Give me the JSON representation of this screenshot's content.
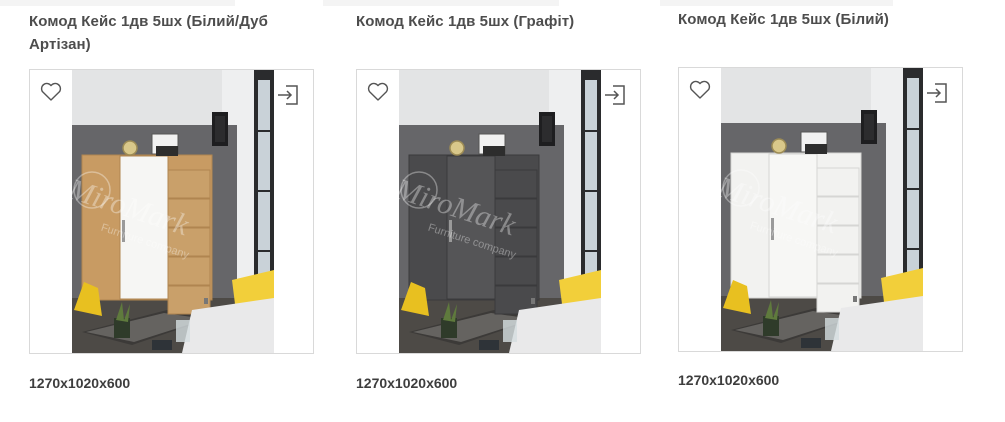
{
  "products": [
    {
      "title": "Комод Кейс 1дв 5шх (Білий/Дуб Артізан)",
      "dimensions": "1270x1020x600",
      "finish": "oak-white",
      "body_color": "#c89b63",
      "door_color": "#f6f6f4",
      "watermark": "MiroMark Furniture company"
    },
    {
      "title": "Комод Кейс 1дв 5шх (Графіт)",
      "dimensions": "1270x1020x600",
      "finish": "graphite",
      "body_color": "#4a4a4c",
      "door_color": "#555557",
      "watermark": "MiroMark Furniture company"
    },
    {
      "title": "Комод Кейс 1дв 5шх (Білий)",
      "dimensions": "1270x1020x600",
      "finish": "white",
      "body_color": "#f2f2f0",
      "door_color": "#f7f7f5",
      "watermark": "MiroMark Furniture company"
    }
  ],
  "icons": {
    "favorite": "heart-icon",
    "compare": "compare-icon"
  }
}
